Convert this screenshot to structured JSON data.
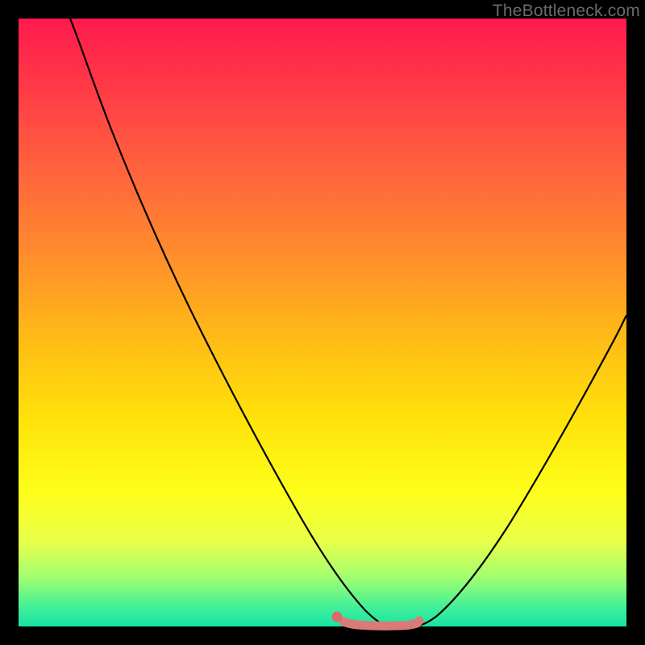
{
  "watermark": "TheBottleneck.com",
  "colors": {
    "frame": "#000000",
    "gradient_top": "#ff1a4d",
    "gradient_bottom": "#18e3a3",
    "curve": "#000000",
    "flat_segment": "#da7a78",
    "flat_dot": "#d86b6b"
  },
  "chart_data": {
    "type": "line",
    "title": "",
    "xlabel": "",
    "ylabel": "",
    "xlim": [
      0,
      100
    ],
    "ylim": [
      0,
      100
    ],
    "series": [
      {
        "name": "bottleneck-curve",
        "x": [
          8.5,
          12,
          16,
          20,
          24,
          28,
          32,
          36,
          40,
          44,
          48,
          50,
          52,
          54,
          55,
          56,
          57,
          58,
          60,
          61,
          63,
          65,
          68,
          72,
          76,
          80,
          84,
          88,
          92,
          96,
          100
        ],
        "y": [
          100,
          93,
          84,
          75.5,
          67.5,
          59.5,
          52,
          44.5,
          37,
          29.5,
          22,
          18.5,
          14.5,
          10.5,
          8,
          6,
          4.5,
          3,
          0,
          0,
          0,
          0,
          3,
          9,
          16,
          23,
          30.5,
          38,
          46,
          54,
          62
        ]
      },
      {
        "name": "optimal-flat-segment",
        "x": [
          52.5,
          65.5
        ],
        "y": [
          0.5,
          0.5
        ]
      }
    ],
    "annotations": [
      {
        "name": "flat-start-dot",
        "x": 52.5,
        "y": 1.2
      },
      {
        "name": "flat-end-dot",
        "x": 65.5,
        "y": 0.8
      }
    ]
  }
}
